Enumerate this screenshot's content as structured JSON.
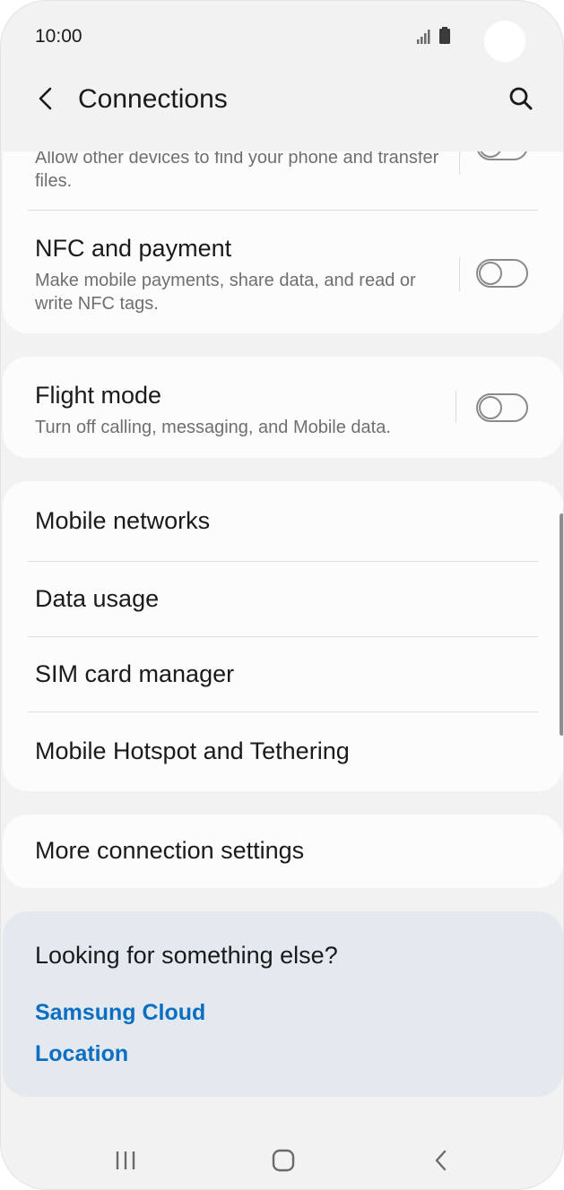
{
  "status_bar": {
    "time": "10:00"
  },
  "header": {
    "title": "Connections"
  },
  "items": {
    "visibility_subtitle": "Allow other devices to find your phone and transfer files.",
    "nfc_title": "NFC and payment",
    "nfc_subtitle": "Make mobile payments, share data, and read or write NFC tags.",
    "flight_title": "Flight mode",
    "flight_subtitle": "Turn off calling, messaging, and Mobile data.",
    "mobile_networks": "Mobile networks",
    "data_usage": "Data usage",
    "sim_manager": "SIM card manager",
    "hotspot": "Mobile Hotspot and Tethering",
    "more_settings": "More connection settings"
  },
  "suggestions": {
    "heading": "Looking for something else?",
    "links": [
      "Samsung Cloud",
      "Location"
    ]
  },
  "toggles": {
    "visibility": false,
    "nfc": false,
    "flight": false
  },
  "colors": {
    "accent_link": "#0a6fc2",
    "background": "#f2f2f2",
    "card": "#fcfcfc",
    "suggestion_card": "#e4e9f0"
  },
  "icons": [
    "back-arrow-icon",
    "search-icon",
    "signal-icon",
    "battery-icon",
    "recents-icon",
    "home-icon",
    "nav-back-icon"
  ]
}
